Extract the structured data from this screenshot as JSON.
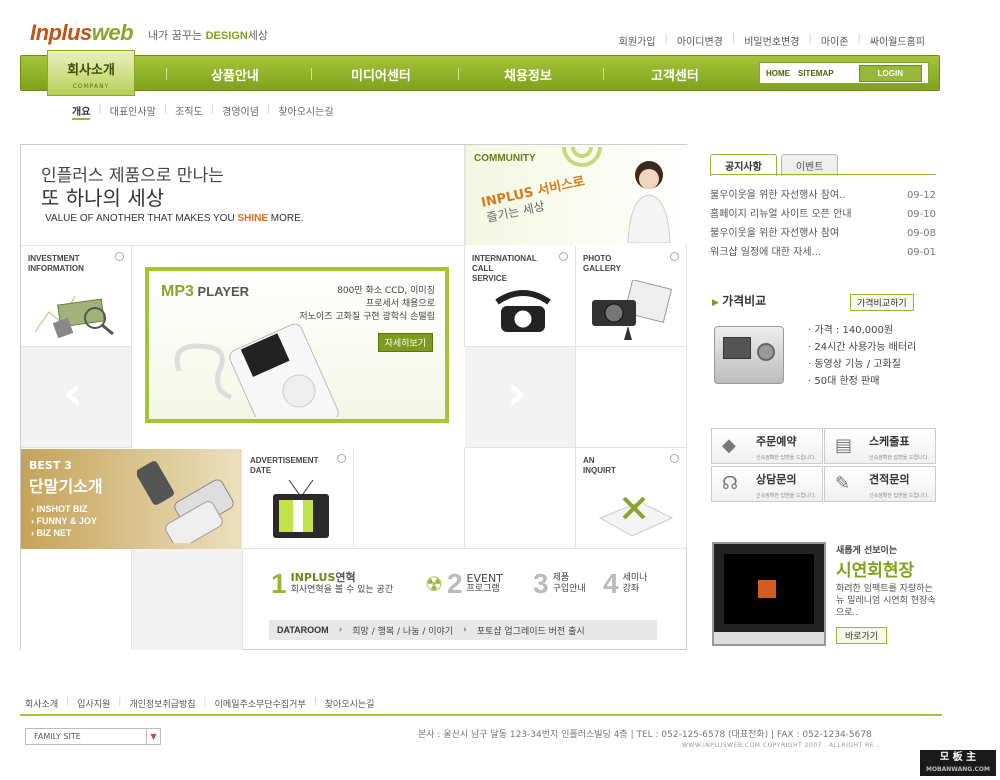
{
  "header": {
    "logo_main": "Inplus",
    "logo_accent": "web",
    "tagline_prefix": "내가 꿈꾸는 ",
    "tagline_design": "DESIGN",
    "tagline_suffix": "세상",
    "top_links": [
      "회원가입",
      "아이디변경",
      "비밀번호변경",
      "마이존",
      "싸이월드홈피"
    ]
  },
  "nav": {
    "active_label": "회사소개",
    "active_sub": "COMPANY",
    "items": [
      "상품안내",
      "미디어센터",
      "채용정보",
      "고객센터"
    ],
    "home": "HOME",
    "sitemap": "SITEMAP",
    "login": "LOGIN"
  },
  "subnav": [
    "개요",
    "대표인사말",
    "조직도",
    "경영이념",
    "찾아오시는길"
  ],
  "hero": {
    "line1": "인플러스 제품으로 만나는",
    "line2": "또 하나의 세상",
    "en_prefix": "VALUE OF ANOTHER THAT MAKES YOU ",
    "en_shine": "SHINE",
    "en_suffix": " MORE."
  },
  "community": {
    "title": "COMMUNITY",
    "band1": "INPLUS 서비스로",
    "band2": "즐기는 세상"
  },
  "cells": {
    "investment": [
      "INVESTMENT",
      "INFORMATION"
    ],
    "call": [
      "INTERNATIONAL",
      "CALL",
      "SERVICE"
    ],
    "photo": [
      "PHOTO",
      "GALLERY"
    ],
    "adv": [
      "ADVERTISEMENT",
      "DATE"
    ],
    "inquiry": [
      "AN",
      "INQUIRT"
    ]
  },
  "mp3": {
    "title": "MP3",
    "title2": " PLAYER",
    "desc1": "800만 화소 CCD, 이미징",
    "desc2": "프로세서 채용으로",
    "desc3": "저노이즈 고화질 구현 광학식 손떨림",
    "btn": "자세히보기"
  },
  "best3": {
    "t1": "BEST 3",
    "t2": "단말기소개",
    "items": [
      "INSHOT BIZ",
      "FUNNY & JOY",
      "BIZ NET"
    ]
  },
  "bottom": {
    "n1": "1",
    "n1_title": "INPLUS",
    "n1_title2": "연혁",
    "n1_sub": "회사연혁을 볼 수 있는 공간",
    "n2": "2",
    "n2_title": "EVENT",
    "n2_sub": "프로그램",
    "n3": "3",
    "n3_title": "제품",
    "n3_sub": "구입안내",
    "n4": "4",
    "n4_title": "세미나",
    "n4_sub": "강좌",
    "dataroom_label": "DATAROOM",
    "dataroom_text": "희망 / 행복 / 나눔 / 이야기",
    "dataroom_news": "포토샵 업그레이드 버전 출시"
  },
  "notice": {
    "tabs": [
      "공지사항",
      "이벤트"
    ],
    "items": [
      {
        "text": "불우이웃을 위한 자선행사 참여..",
        "date": "09-12"
      },
      {
        "text": "홈페이지 리뉴얼 사이트 오픈 안내",
        "date": "09-10"
      },
      {
        "text": "불우이웃을 위한 자선행사 참여",
        "date": "09-08"
      },
      {
        "text": "워크샵 일정에 대한 자세...",
        "date": "09-01"
      }
    ]
  },
  "price": {
    "title": "가격비교",
    "btn": "가격비교하기",
    "items": [
      "가격 : 140,000원",
      "24시간 사용가능 배터리",
      "동영상 기능 / 고화질",
      "50대 한정 판매"
    ]
  },
  "services": [
    {
      "name": "주문예약",
      "sub": "신속정확한 답변을 드립니다.",
      "icon": "◆"
    },
    {
      "name": "스케줄표",
      "sub": "신속정확한 답변을 드립니다.",
      "icon": "▤"
    },
    {
      "name": "상담문의",
      "sub": "신속정확한 답변을 드립니다.",
      "icon": "☊"
    },
    {
      "name": "견적문의",
      "sub": "신속정확한 답변을 드립니다.",
      "icon": "✎"
    }
  ],
  "promo": {
    "small": "새롭게 선보이는",
    "big": "시연회현장",
    "desc": "화려한 임팩트를 자랑하는 뉴 밀레니엄 시연회 현장속으로..",
    "btn": "바로가기"
  },
  "footer": {
    "links": [
      "회사소개",
      "입사지원",
      "개인정보취급방침",
      "이메일주소무단수집거부",
      "찾아오시는길"
    ],
    "family": "FAMILY SITE",
    "address": "본사 : 울산시 남구 달동 123-34번지 인플러스빌딩 4층   |   TEL : 052-125-6578 (대표전화)   |   FAX : 052-1234-5678",
    "copyright": "WWW.INPLUSWEB.COM COPYRIGHT 2007 . ALLRIGHT RE...",
    "badge": "모 板 主",
    "badge_sub": "MOBANWANG.COM"
  }
}
